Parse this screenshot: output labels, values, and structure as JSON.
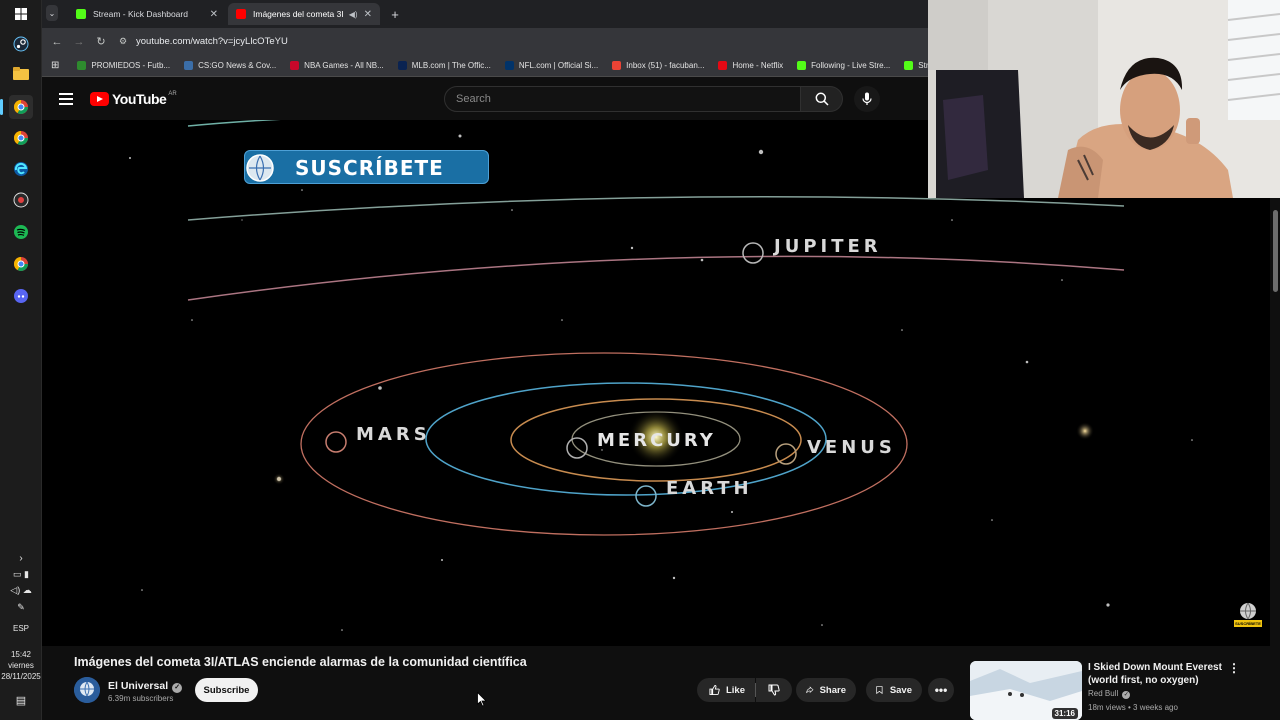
{
  "taskbar": {
    "clock_time": "15:42",
    "clock_day": "viernes",
    "clock_date": "28/11/2025",
    "language": "ESP"
  },
  "browser": {
    "tabs": [
      {
        "title": "Stream - Kick Dashboard",
        "active": false,
        "favicon_color": "#53fc18"
      },
      {
        "title": "Imágenes del cometa 3I/AT",
        "active": true,
        "favicon_color": "#ff0000"
      }
    ],
    "url": "youtube.com/watch?v=jcyLlcOTeYU",
    "bookmarks": [
      {
        "label": "PROMIEDOS - Futb...",
        "color": "#2e8b2e"
      },
      {
        "label": "CS:GO News & Cov...",
        "color": "#3b6ea8"
      },
      {
        "label": "NBA Games - All NB...",
        "color": "#c9082a"
      },
      {
        "label": "MLB.com | The Offic...",
        "color": "#0a2351"
      },
      {
        "label": "NFL.com | Official Si...",
        "color": "#013369"
      },
      {
        "label": "Inbox (51) - facuban...",
        "color": "#ea4335"
      },
      {
        "label": "Home - Netflix",
        "color": "#e50914"
      },
      {
        "label": "Following - Live Stre...",
        "color": "#53fc18"
      },
      {
        "label": "Stream - K",
        "color": "#53fc18"
      }
    ]
  },
  "youtube": {
    "logo": "YouTube",
    "country": "AR",
    "search_placeholder": "Search"
  },
  "video_frame": {
    "subscribe_banner": "SUSCRÍBETE",
    "planet_labels": {
      "jupiter": "JUPITER",
      "mars": "MARS",
      "mercury": "MERCURY",
      "venus": "VENUS",
      "earth": "EARTH"
    },
    "watermark": "SUSCRÍBETE"
  },
  "video_info": {
    "title": "Imágenes del cometa 3I/ATLAS enciende alarmas de la comunidad científica",
    "channel": "El Universal",
    "subscribers": "6.39m subscribers",
    "subscribe_label": "Subscribe",
    "like_label": "Like",
    "share_label": "Share",
    "save_label": "Save"
  },
  "recommendation": {
    "title": "I Skied Down Mount Everest (world first, no oxygen)",
    "channel": "Red Bull",
    "meta": "18m views • 3 weeks ago",
    "duration": "31:16"
  },
  "colors": {
    "yt_red": "#ff0000",
    "background": "#0f0f0f",
    "kick_green": "#53fc18"
  }
}
